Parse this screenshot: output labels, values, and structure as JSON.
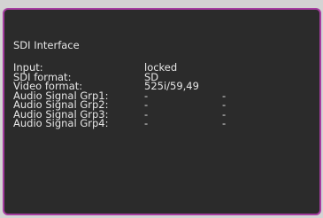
{
  "panel": {
    "title": "SDI Interface",
    "border_color": "#a53da0",
    "background_color": "#2b2b2b",
    "rows": [
      {
        "label": "Input:",
        "value": "locked",
        "value2": ""
      },
      {
        "label": "SDI format:",
        "value": "SD",
        "value2": ""
      },
      {
        "label": "Video format:",
        "value": "525i/59,49",
        "value2": ""
      },
      {
        "label": "Audio Signal Grp1:",
        "value": "-",
        "value2": "-"
      },
      {
        "label": "Audio Signal Grp2:",
        "value": "-",
        "value2": "-"
      },
      {
        "label": "Audio Signal Grp3:",
        "value": "-",
        "value2": "-"
      },
      {
        "label": "Audio Signal Grp4:",
        "value": "-",
        "value2": "-"
      }
    ]
  }
}
